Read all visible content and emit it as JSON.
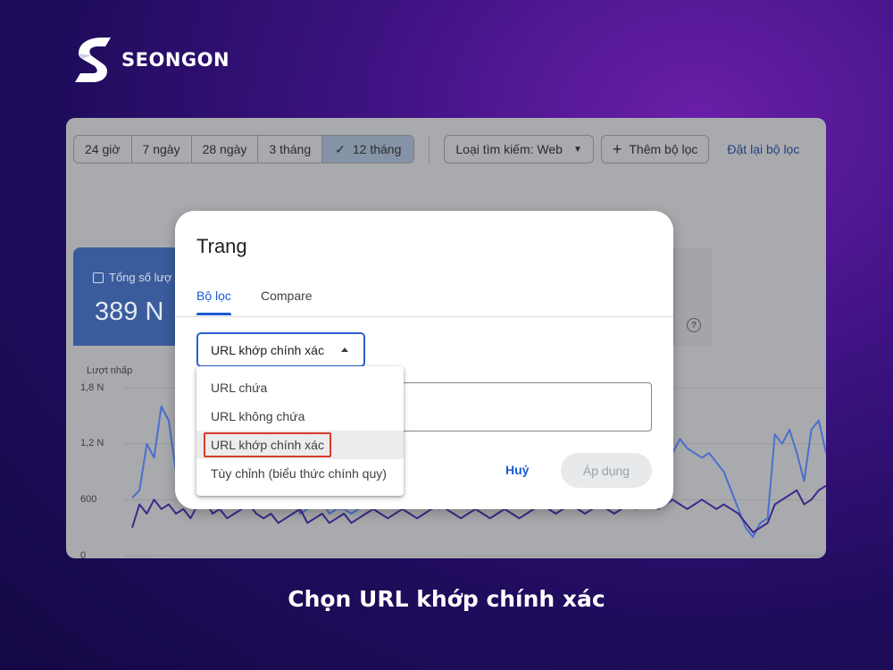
{
  "brand": {
    "name": "SEONGON"
  },
  "toolbar": {
    "date_ranges": [
      {
        "label": "24 giờ",
        "active": false
      },
      {
        "label": "7 ngày",
        "active": false
      },
      {
        "label": "28 ngày",
        "active": false
      },
      {
        "label": "3 tháng",
        "active": false
      },
      {
        "label": "12 tháng",
        "active": true
      }
    ],
    "search_type": "Loại tìm kiếm: Web",
    "add_filter": "Thêm bộ lọc",
    "reset_filter": "Đặt lại bộ lọc"
  },
  "metric": {
    "label": "Tổng số lượ",
    "value": "389 N"
  },
  "chart_data": {
    "type": "line",
    "ylabel": "Lượt nhấp",
    "y_ticks": [
      "0",
      "600",
      "1,2 N",
      "1,8 N"
    ],
    "ylim": [
      0,
      1800
    ],
    "series": [
      {
        "color": "#4a6fcf",
        "values": [
          620,
          700,
          1200,
          1050,
          1600,
          1450,
          900,
          1550,
          1500,
          850,
          1520,
          950,
          1250,
          850,
          1050,
          750,
          950,
          700,
          650,
          600,
          550,
          600,
          700,
          450,
          500,
          550,
          600,
          450,
          500,
          500,
          450,
          500,
          550,
          600,
          650,
          600,
          550,
          500,
          600,
          650,
          600,
          550,
          500,
          550,
          600,
          550,
          500,
          550,
          600,
          600,
          650,
          550,
          700,
          650,
          600,
          650,
          700,
          600,
          650,
          600,
          650,
          700,
          750,
          700,
          650,
          600,
          650,
          700,
          750,
          700,
          1050,
          1150,
          1300,
          1200,
          1100,
          1250,
          1150,
          1100,
          1050,
          1100,
          1000,
          900,
          700,
          500,
          300,
          200,
          350,
          400,
          1300,
          1200,
          1350,
          1100,
          800,
          1350,
          1450,
          1100
        ]
      },
      {
        "color": "#3a2a8a",
        "values": [
          300,
          550,
          450,
          600,
          500,
          550,
          450,
          500,
          400,
          550,
          600,
          450,
          500,
          400,
          450,
          500,
          550,
          450,
          400,
          450,
          350,
          400,
          450,
          500,
          350,
          400,
          450,
          350,
          400,
          450,
          350,
          400,
          450,
          500,
          450,
          400,
          450,
          500,
          450,
          400,
          450,
          500,
          550,
          500,
          450,
          400,
          450,
          500,
          450,
          400,
          450,
          500,
          450,
          400,
          450,
          500,
          550,
          500,
          450,
          500,
          550,
          500,
          450,
          500,
          550,
          500,
          450,
          500,
          550,
          500,
          600,
          550,
          500,
          550,
          600,
          550,
          500,
          550,
          600,
          550,
          500,
          550,
          500,
          450,
          350,
          250,
          300,
          350,
          550,
          600,
          650,
          700,
          550,
          600,
          700,
          750
        ]
      }
    ]
  },
  "dialog": {
    "title": "Trang",
    "tabs": {
      "filter": "Bộ lọc",
      "compare": "Compare"
    },
    "select_value": "URL khớp chính xác",
    "cancel": "Huỷ",
    "apply": "Áp dụng"
  },
  "menu": {
    "items": [
      {
        "label": "URL chứa",
        "selected": false
      },
      {
        "label": "URL không chứa",
        "selected": false
      },
      {
        "label": "URL khớp chính xác",
        "selected": true
      },
      {
        "label": "Tùy chỉnh (biểu thức chính quy)",
        "selected": false
      }
    ]
  },
  "caption": "Chọn URL khớp chính xác",
  "colors": {
    "accent": "#1a5bd1",
    "highlight": "#d93a2b"
  }
}
